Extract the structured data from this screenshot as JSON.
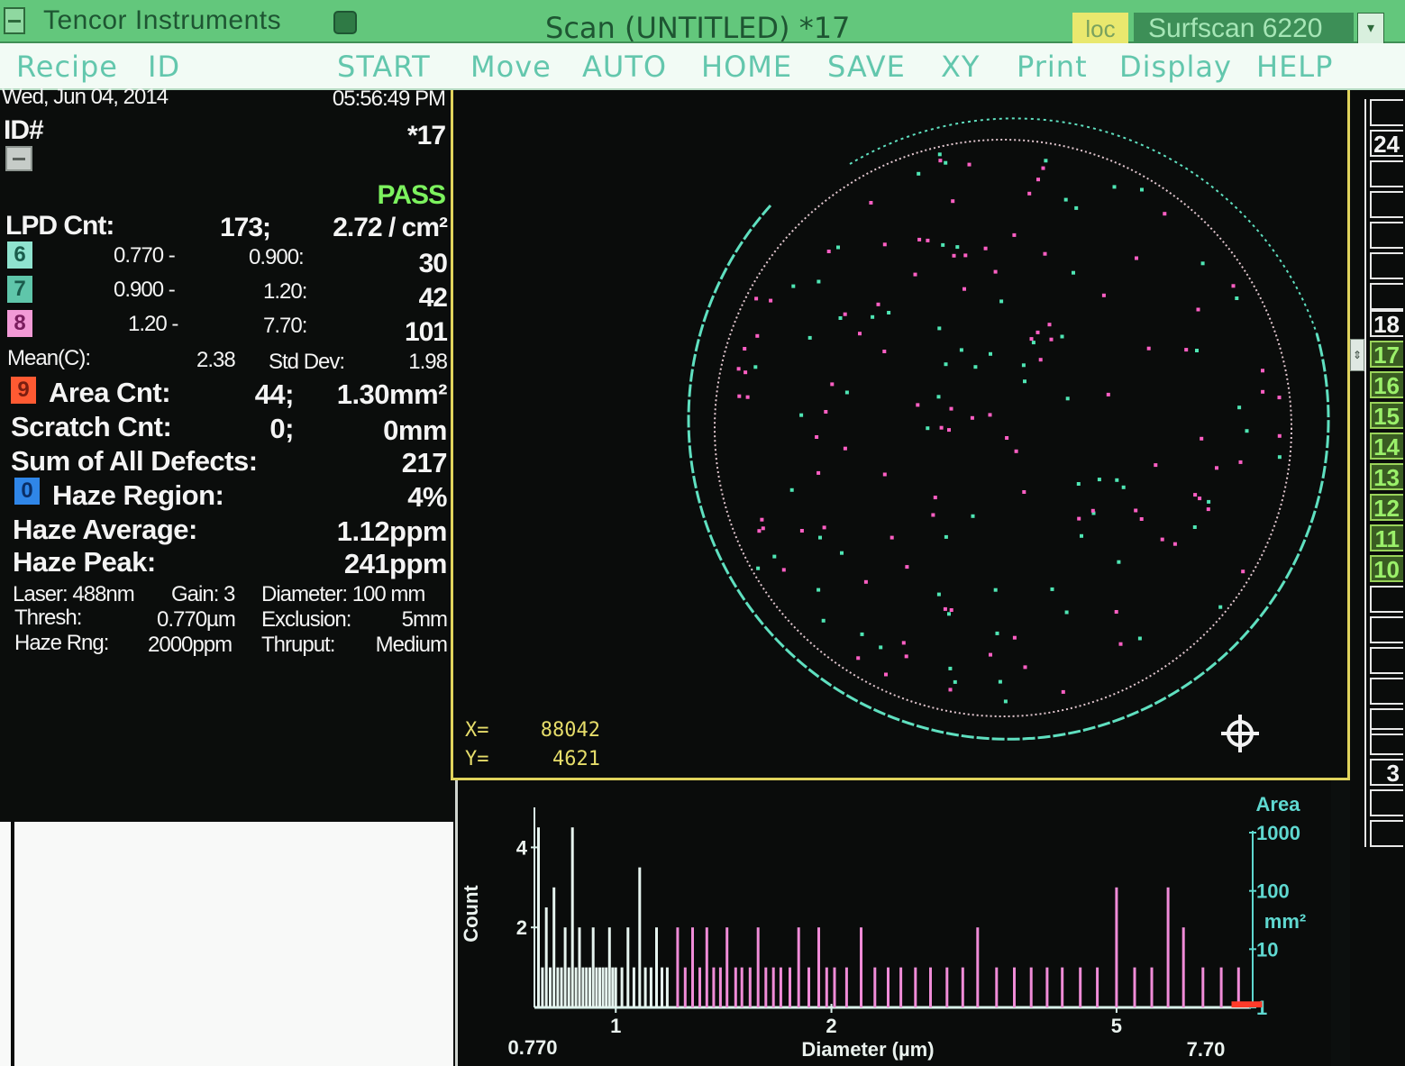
{
  "titlebar": {
    "app_title": "Tencor Instruments",
    "scan_title": "Scan (UNTITLED)  *17",
    "loc_label": "loc",
    "model": "Surfscan 6220",
    "dropdown": "▾"
  },
  "menu": [
    "Recipe",
    "ID",
    "START",
    "Move",
    "AUTO",
    "HOME",
    "SAVE",
    "XY",
    "Print",
    "Display",
    "HELP"
  ],
  "stats": {
    "date": "Wed, Jun 04, 2014",
    "time": "05:56:49 PM",
    "id_label": "ID#",
    "id_value": "*17",
    "result": "PASS",
    "lpd_label": "LPD Cnt:",
    "lpd_count": "173;",
    "lpd_density": "2.72 / cm²",
    "bins": [
      {
        "tag": "6",
        "low": "0.770 -",
        "high": "0.900:",
        "count": "30"
      },
      {
        "tag": "7",
        "low": "0.900 -",
        "high": "1.20:",
        "count": "42"
      },
      {
        "tag": "8",
        "low": "1.20 -",
        "high": "7.70:",
        "count": "101"
      }
    ],
    "mean_label": "Mean(C):",
    "mean_value": "2.38",
    "std_label": "Std Dev:",
    "std_value": "1.98",
    "area_tag": "9",
    "area_label": "Area Cnt:",
    "area_count": "44;",
    "area_value": "1.30mm²",
    "scratch_label": "Scratch Cnt:",
    "scratch_count": "0;",
    "scratch_value": "0mm",
    "sum_label": "Sum of All Defects:",
    "sum_value": "217",
    "haze_tag": "0",
    "haze_region_label": "Haze Region:",
    "haze_region_value": "4%",
    "haze_avg_label": "Haze Average:",
    "haze_avg_value": "1.12ppm",
    "haze_peak_label": "Haze Peak:",
    "haze_peak_value": "241ppm",
    "laser": "Laser: 488nm",
    "gain": "Gain: 3",
    "diameter": "Diameter: 100 mm",
    "thresh_label": "Thresh:",
    "thresh_value": "0.770µm",
    "exclusion_label": "Exclusion:",
    "exclusion_value": "5mm",
    "hazerng_label": "Haze Rng:",
    "hazerng_value": "2000ppm",
    "thruput_label": "Thruput:",
    "thruput_value": "Medium"
  },
  "map": {
    "x_label": "X=",
    "x_value": "88042",
    "y_label": "Y=",
    "y_value": "4621",
    "colors": {
      "bin7": "#4fe6b4",
      "bin8": "#ff5fc4",
      "edge": "#5fe0c0",
      "exclusion": "#e2c7cf"
    }
  },
  "chart_data": {
    "type": "bar",
    "xlabel": "Diameter (µm)",
    "ylabel": "Count",
    "x_scale": "log",
    "xlim": [
      0.77,
      7.7
    ],
    "x_ticks": [
      "1",
      "2",
      "5"
    ],
    "x_end_labels": [
      "0.770",
      "7.70"
    ],
    "y_ticks": [
      "2",
      "4"
    ],
    "ylim": [
      0,
      5
    ],
    "right_axis_label": "Area",
    "right_axis_unit": "mm²",
    "right_ticks": [
      "1000",
      "100",
      "10",
      "1"
    ],
    "series": [
      {
        "color": "#e6f4ef",
        "x": [
          0.78,
          0.79,
          0.8,
          0.81,
          0.82,
          0.83,
          0.84,
          0.85,
          0.86,
          0.87,
          0.88,
          0.89,
          0.9,
          0.91,
          0.92,
          0.93,
          0.94,
          0.95,
          0.96,
          0.97,
          0.98,
          0.99,
          1.0,
          1.02,
          1.04,
          1.06,
          1.08,
          1.1,
          1.12,
          1.14,
          1.16,
          1.18
        ],
        "values": [
          4.5,
          1,
          2.5,
          1,
          3,
          1,
          1,
          2,
          1,
          4.5,
          1,
          2,
          1,
          1,
          1,
          2,
          1,
          1,
          1,
          1,
          2,
          1,
          1,
          1,
          2,
          1,
          3.5,
          1,
          1,
          2,
          1,
          1
        ]
      },
      {
        "color": "#f08cd8",
        "x": [
          1.22,
          1.25,
          1.28,
          1.31,
          1.34,
          1.37,
          1.4,
          1.43,
          1.47,
          1.5,
          1.54,
          1.58,
          1.62,
          1.66,
          1.7,
          1.75,
          1.8,
          1.86,
          1.92,
          1.97,
          2.02,
          2.1,
          2.2,
          2.3,
          2.4,
          2.5,
          2.62,
          2.75,
          2.9,
          3.05,
          3.2,
          3.4,
          3.6,
          3.8,
          4.0,
          4.2,
          4.45,
          4.7,
          5.0,
          5.3,
          5.6,
          5.9,
          6.2,
          6.6,
          7.0,
          7.4
        ],
        "values": [
          2,
          1,
          2,
          1,
          2,
          1,
          1,
          2,
          1,
          1,
          1,
          2,
          1,
          1,
          1,
          1,
          2,
          1,
          2,
          1,
          1,
          1,
          2,
          1,
          1,
          1,
          1,
          1,
          1,
          1,
          2,
          1,
          1,
          1,
          1,
          1,
          1,
          1,
          3,
          1,
          1,
          3,
          2,
          1,
          1,
          1
        ]
      },
      {
        "color": "#ff3b2a",
        "x": [
          7.6
        ],
        "values": [
          0.15
        ]
      }
    ]
  },
  "rightstrip": {
    "labels": [
      "24",
      "18",
      "17",
      "16",
      "15",
      "14",
      "13",
      "12",
      "11",
      "10",
      "3"
    ]
  }
}
